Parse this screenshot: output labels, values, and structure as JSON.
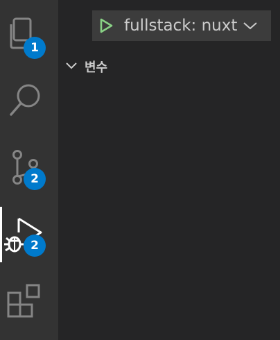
{
  "activity_bar": {
    "explorer": {
      "badge": "1"
    },
    "source_control": {
      "badge": "2"
    },
    "run_debug": {
      "badge": "2"
    }
  },
  "debug_toolbar": {
    "configuration": "fullstack: nuxt"
  },
  "variables_section": {
    "title": "변수"
  },
  "colors": {
    "activity_bar": "#333333",
    "sidebar": "#252526",
    "badge": "#007acc",
    "play": "#89d185",
    "toolbar": "#3c3c3c"
  }
}
